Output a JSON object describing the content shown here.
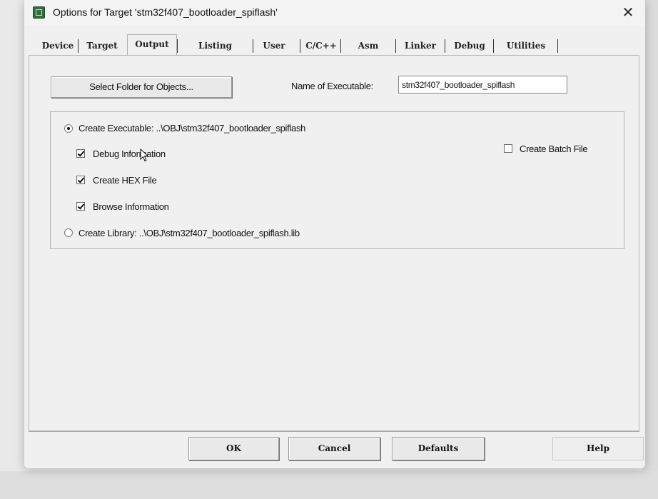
{
  "dialog": {
    "title": "Options for Target 'stm32f407_bootloader_spiflash'",
    "close_glyph": "✕"
  },
  "tabs": [
    {
      "label": "Device",
      "active": false
    },
    {
      "label": "Target",
      "active": false
    },
    {
      "label": "Output",
      "active": true
    },
    {
      "label": "Listing",
      "active": false
    },
    {
      "label": "User",
      "active": false
    },
    {
      "label": "C/C++",
      "active": false
    },
    {
      "label": "Asm",
      "active": false
    },
    {
      "label": "Linker",
      "active": false
    },
    {
      "label": "Debug",
      "active": false
    },
    {
      "label": "Utilities",
      "active": false
    }
  ],
  "output": {
    "select_folder_label": "Select Folder for Objects...",
    "name_label": "Name of Executable:",
    "name_value": "stm32f407_bootloader_spiflash",
    "create_executable": {
      "label": "Create Executable:  ..\\OBJ\\stm32f407_bootloader_spiflash",
      "selected": true
    },
    "debug_info": {
      "label": "Debug Information",
      "checked": true
    },
    "create_hex": {
      "label": "Create HEX File",
      "checked": true
    },
    "browse_info": {
      "label": "Browse Information",
      "checked": true
    },
    "create_library": {
      "label": "Create Library:  ..\\OBJ\\stm32f407_bootloader_spiflash.lib",
      "selected": false
    },
    "create_batch": {
      "label": "Create Batch File",
      "checked": false
    }
  },
  "buttons": {
    "ok": "OK",
    "cancel": "Cancel",
    "defaults": "Defaults",
    "help": "Help"
  },
  "icons": {
    "app": "keil-uvision-icon",
    "close": "close-icon",
    "cursor": "mouse-pointer-icon"
  }
}
